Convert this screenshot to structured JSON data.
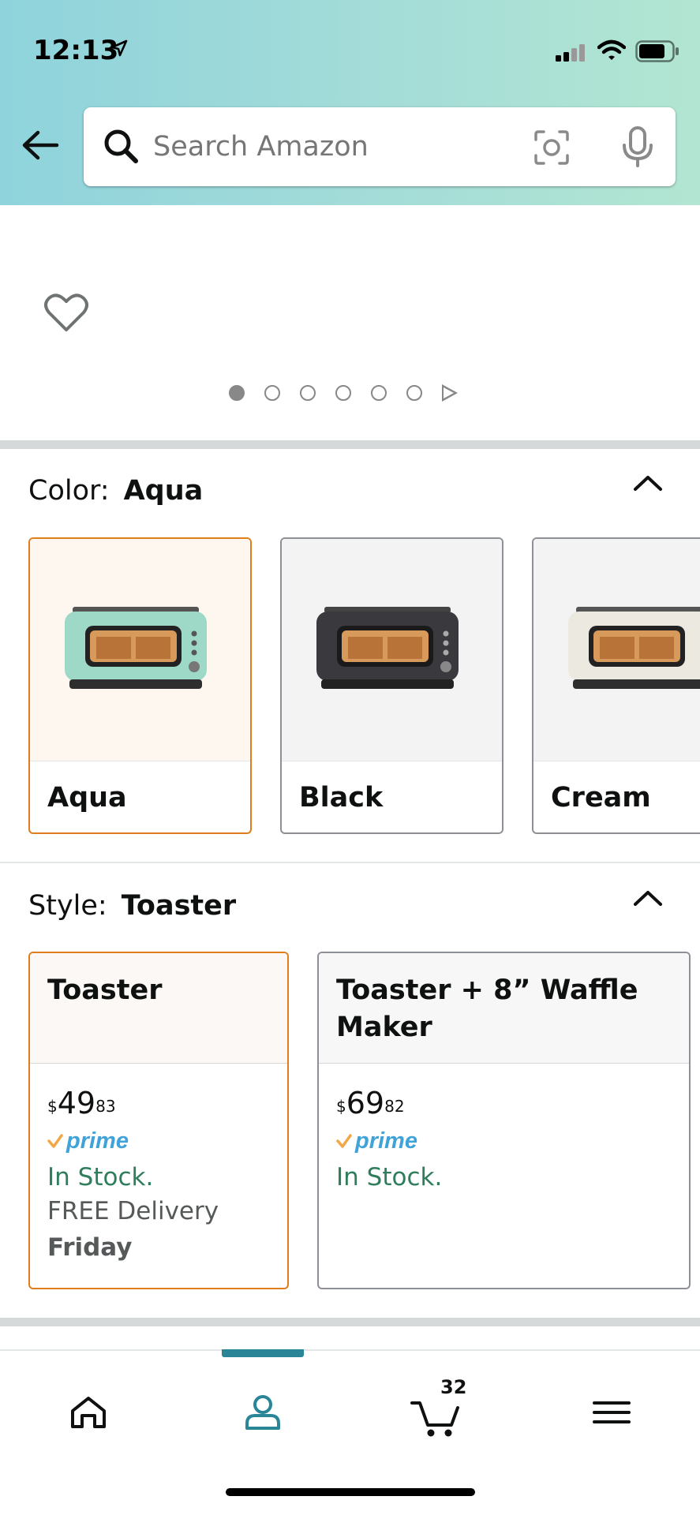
{
  "status_bar": {
    "time": "12:13"
  },
  "search": {
    "placeholder": "Search Amazon"
  },
  "colors": {
    "accent_selected": "#e07e1d",
    "in_stock": "#2e7d5b",
    "prime_blue": "#3fa2d9",
    "nav_active": "#2a8597"
  },
  "gallery": {
    "image_count": 6,
    "current_index": 1
  },
  "color_section": {
    "label": "Color:",
    "selected": "Aqua",
    "options": [
      {
        "name": "Aqua",
        "swatch_color": "#9ed8c6"
      },
      {
        "name": "Black",
        "swatch_color": "#3a3a3e"
      },
      {
        "name": "Cream",
        "swatch_color": "#ece9e0"
      }
    ]
  },
  "style_section": {
    "label": "Style:",
    "selected": "Toaster",
    "options": [
      {
        "title": "Toaster",
        "price_currency": "$",
        "price_whole": "49",
        "price_fraction": "83",
        "prime": "prime",
        "stock": "In Stock.",
        "delivery": "FREE Delivery",
        "delivery_day": "Friday"
      },
      {
        "title": "Toaster + 8” Waffle Maker",
        "price_currency": "$",
        "price_whole": "69",
        "price_fraction": "82",
        "prime": "prime",
        "stock": "In Stock."
      }
    ]
  },
  "bottom_nav": {
    "items": [
      "home-icon",
      "account-icon",
      "cart-icon",
      "menu-icon"
    ],
    "active": "account-icon",
    "cart_count": "32"
  }
}
